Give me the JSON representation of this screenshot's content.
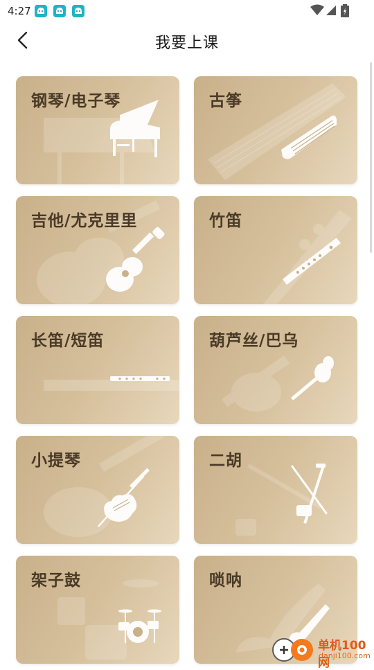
{
  "status_bar": {
    "time": "4:27"
  },
  "header": {
    "title": "我要上课"
  },
  "courses": [
    {
      "label": "钢琴/电子琴",
      "icon": "piano-icon"
    },
    {
      "label": "古筝",
      "icon": "guzheng-icon"
    },
    {
      "label": "吉他/尤克里里",
      "icon": "ukulele-icon"
    },
    {
      "label": "竹笛",
      "icon": "bamboo-flute-icon"
    },
    {
      "label": "长笛/短笛",
      "icon": "flute-icon"
    },
    {
      "label": "葫芦丝/巴乌",
      "icon": "hulusi-icon"
    },
    {
      "label": "小提琴",
      "icon": "violin-icon"
    },
    {
      "label": "二胡",
      "icon": "erhu-icon"
    },
    {
      "label": "架子鼓",
      "icon": "drum-kit-icon"
    },
    {
      "label": "唢呐",
      "icon": "suona-icon"
    }
  ],
  "watermark": {
    "title": "单机100网",
    "url": "danji100.com"
  },
  "colors": {
    "card_start": "#c8b08a",
    "card_end": "#e7d7bc",
    "label": "#4a3a27"
  }
}
